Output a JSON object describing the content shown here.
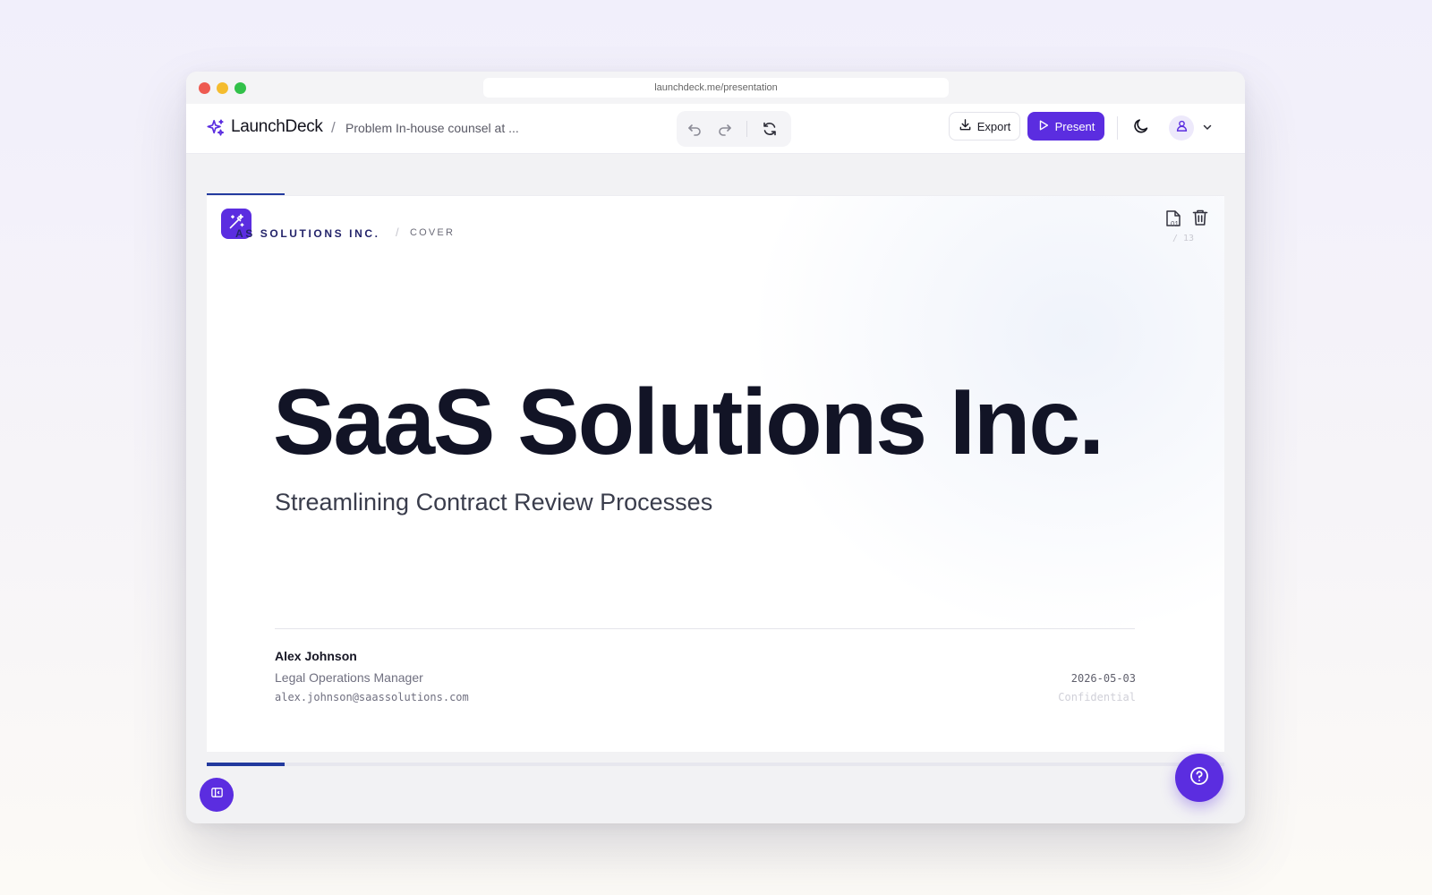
{
  "browser": {
    "url": "launchdeck.me/presentation"
  },
  "app": {
    "name": "LaunchDeck",
    "breadcrumb_separator": "/",
    "document_title": "Problem In-house counsel at ...",
    "export_label": "Export",
    "present_label": "Present"
  },
  "icons": {
    "logo": "sparkle-icon",
    "undo": "undo-icon",
    "redo": "redo-icon",
    "refresh": "refresh-icon",
    "export": "download-icon",
    "present": "play-icon",
    "theme": "moon-icon",
    "avatar": "user-icon",
    "menu": "chevron-down-icon",
    "magic": "magic-wand-icon",
    "slide_page": "page-icon",
    "delete": "trash-icon",
    "panel": "sidebar-toggle-icon",
    "help": "help-icon"
  },
  "slide": {
    "company_eyebrow": "AS SOLUTIONS INC.",
    "eyebrow_separator": "/",
    "section": "COVER",
    "page_number": "01",
    "page_total": "/ 13",
    "title": "SaaS Solutions Inc.",
    "subtitle": "Streamlining Contract Review Processes",
    "presenter_name": "Alex Johnson",
    "presenter_role": "Legal Operations Manager",
    "presenter_email": "alex.johnson@saassolutions.com",
    "date": "2026-05-03",
    "classification": "Confidential"
  },
  "progress": {
    "current_slide": 1,
    "total_slides": 13,
    "fraction": 0.0769
  },
  "colors": {
    "accent": "#5b2de0",
    "progress": "#233a9e",
    "headline": "#121426"
  }
}
